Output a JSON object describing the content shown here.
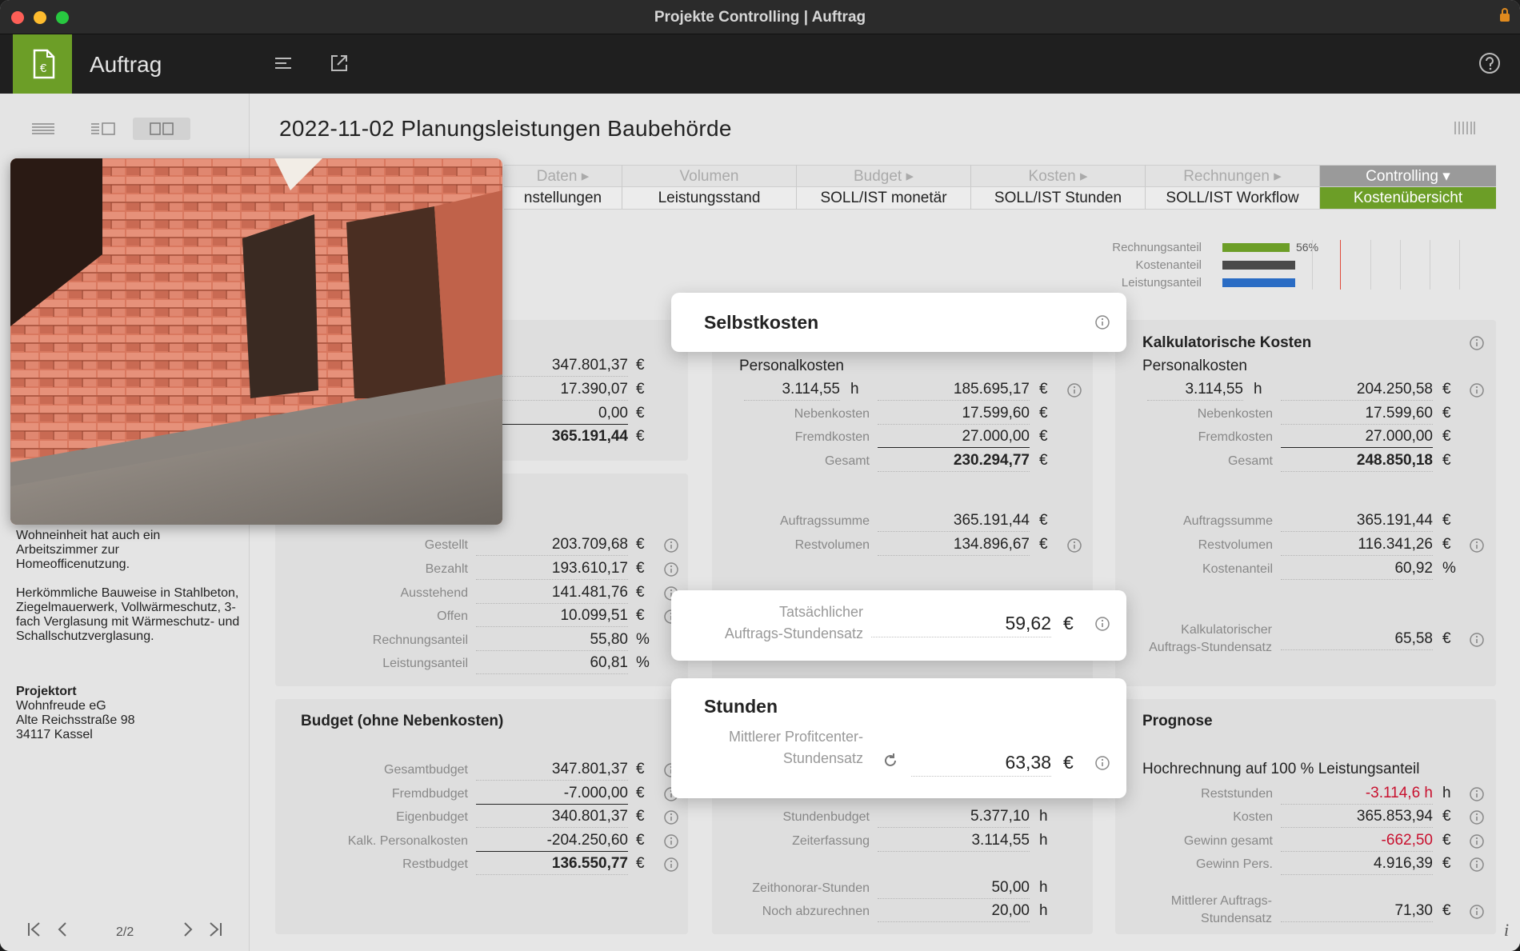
{
  "window": {
    "title": "Projekte Controlling | Auftrag"
  },
  "appbar": {
    "title": "Auftrag"
  },
  "page": {
    "title": "2022-11-02 Planungsleistungen Baubehörde"
  },
  "tabs": {
    "top": [
      "Daten ▸",
      "Volumen",
      "Budget ▸",
      "Kosten ▸",
      "Rechnungen ▸",
      "Controlling ▾"
    ],
    "bottom": [
      "nstellungen",
      "Leistungsstand",
      "SOLL/IST monetär",
      "SOLL/IST Stunden",
      "SOLL/IST Workflow",
      "Kostenübersicht"
    ],
    "active_color": "#6c9e27"
  },
  "legend": {
    "items": [
      {
        "label": "Rechnungsanteil",
        "color": "#6c9e27",
        "value": 0.56
      },
      {
        "label": "Kostenanteil",
        "color": "#4a4a4a",
        "value": 0.61
      },
      {
        "label": "Leistungsanteil",
        "color": "#2a6cc4",
        "value": 0.61
      }
    ],
    "pct": "56%"
  },
  "sidebar": {
    "desc1": "Wohneinheit hat auch ein Arbeitszimmer zur Homeofficenutzung.",
    "desc2": "Herkömmliche Bauweise in Stahlbeton, Ziegelmauerwerk, Vollwärmeschutz, 3-fach Verglasung mit Wärmeschutz- und Schallschutzverglasung.",
    "place_label": "Projektort",
    "place_lines": [
      "Wohnfreude eG",
      "Alte Reichsstraße 98",
      "34117 Kassel"
    ],
    "pager": "2/2"
  },
  "volume": {
    "values": [
      "347.801,37",
      "17.390,07",
      "0,00",
      "365.191,44"
    ],
    "unit": "€"
  },
  "invoices": {
    "rows": [
      {
        "label": "Gestellt",
        "value": "203.709,68",
        "unit": "€"
      },
      {
        "label": "Bezahlt",
        "value": "193.610,17",
        "unit": "€"
      },
      {
        "label": "Ausstehend",
        "value": "141.481,76",
        "unit": "€"
      },
      {
        "label": "Offen",
        "value": "10.099,51",
        "unit": "€"
      },
      {
        "label": "Rechnungsanteil",
        "value": "55,80",
        "unit": "%"
      },
      {
        "label": "Leistungsanteil",
        "value": "60,81",
        "unit": "%"
      }
    ]
  },
  "budget": {
    "title": "Budget (ohne Nebenkosten)",
    "rows": [
      {
        "label": "Gesamtbudget",
        "value": "347.801,37",
        "unit": "€"
      },
      {
        "label": "Fremdbudget",
        "value": "-7.000,00",
        "unit": "€"
      },
      {
        "label": "Eigenbudget",
        "value": "340.801,37",
        "unit": "€"
      },
      {
        "label": "Kalk. Personalkosten",
        "value": "-204.250,60",
        "unit": "€"
      },
      {
        "label": "Restbudget",
        "value": "136.550,77",
        "unit": "€"
      }
    ]
  },
  "selbstkosten": {
    "title": "Selbstkosten",
    "sub": "Personalkosten",
    "hours": "3.114,55",
    "hours_unit": "h",
    "personal": "185.695,17",
    "rows": [
      {
        "label": "Nebenkosten",
        "value": "17.599,60",
        "unit": "€"
      },
      {
        "label": "Fremdkosten",
        "value": "27.000,00",
        "unit": "€"
      },
      {
        "label": "Gesamt",
        "value": "230.294,77",
        "unit": "€"
      },
      {
        "label": "Auftragssumme",
        "value": "365.191,44",
        "unit": "€"
      },
      {
        "label": "Restvolumen",
        "value": "134.896,67",
        "unit": "€"
      }
    ],
    "rate_label1": "Tatsächlicher",
    "rate_label2": "Auftrags-Stundensatz",
    "rate_value": "59,62",
    "unit": "€"
  },
  "kalk": {
    "title": "Kalkulatorische Kosten",
    "sub": "Personalkosten",
    "hours": "3.114,55",
    "hours_unit": "h",
    "personal": "204.250,58",
    "rows": [
      {
        "label": "Nebenkosten",
        "value": "17.599,60",
        "unit": "€"
      },
      {
        "label": "Fremdkosten",
        "value": "27.000,00",
        "unit": "€"
      },
      {
        "label": "Gesamt",
        "value": "248.850,18",
        "unit": "€"
      },
      {
        "label": "Auftragssumme",
        "value": "365.191,44",
        "unit": "€"
      },
      {
        "label": "Restvolumen",
        "value": "116.341,26",
        "unit": "€"
      },
      {
        "label": "Kostenanteil",
        "value": "60,92",
        "unit": "%"
      }
    ],
    "rate_label1": "Kalkulatorischer",
    "rate_label2": "Auftrags-Stundensatz",
    "rate_value": "65,58",
    "unit": "€"
  },
  "stunden": {
    "title": "Stunden",
    "rate_label1": "Mittlerer Profitcenter-",
    "rate_label2": "Stundensatz",
    "rate_value": "63,38",
    "unit": "€",
    "rows": [
      {
        "label": "Stundenbudget",
        "value": "5.377,10",
        "unit": "h"
      },
      {
        "label": "Zeiterfassung",
        "value": "3.114,55",
        "unit": "h"
      },
      {
        "label": "Zeithonorar-Stunden",
        "value": "50,00",
        "unit": "h"
      },
      {
        "label": "Noch abzurechnen",
        "value": "20,00",
        "unit": "h"
      }
    ]
  },
  "prognose": {
    "title": "Prognose",
    "sub": "Hochrechnung auf 100 % Leistungsanteil",
    "rows": [
      {
        "label": "Reststunden",
        "value": "-3.114,6 h",
        "unit": "h"
      },
      {
        "label": "Kosten",
        "value": "365.853,94",
        "unit": "€"
      },
      {
        "label": "Gewinn gesamt",
        "value": "-662,50",
        "unit": "€"
      },
      {
        "label": "Gewinn Pers.",
        "value": "4.916,39",
        "unit": "€"
      }
    ],
    "rate_label1": "Mittlerer Auftrags-",
    "rate_label2": "Stundensatz",
    "rate_value": "71,30",
    "unit": "€"
  }
}
